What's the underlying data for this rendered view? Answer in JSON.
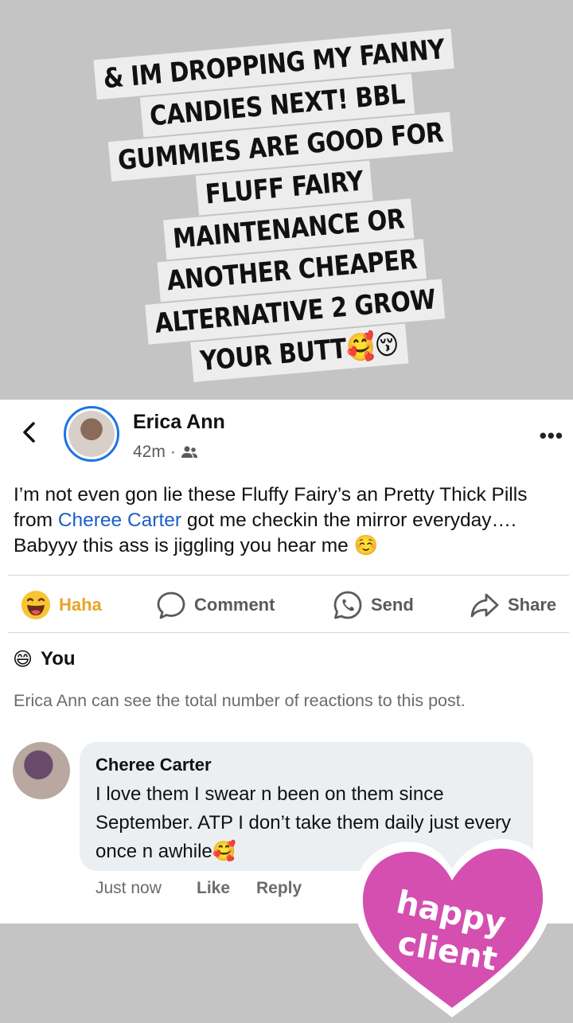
{
  "caption": {
    "lines": [
      "& IM DROPPING MY FANNY",
      "CANDIES NEXT! BBL",
      "GUMMIES ARE GOOD FOR",
      "FLUFF FAIRY",
      "MAINTENANCE OR",
      "ANOTHER CHEAPER",
      "ALTERNATIVE 2 GROW",
      "YOUR BUTT🥰😚"
    ]
  },
  "post": {
    "author": "Erica Ann",
    "time": "42m",
    "text_before_link": "I’m not even gon lie these Fluffy Fairy’s an Pretty Thick Pills from ",
    "link": "Cheree Carter",
    "text_after_link": " got me checkin the mirror everyday…. Babyyy this ass is jiggling you hear me ☺️"
  },
  "actions": {
    "haha": "Haha",
    "comment": "Comment",
    "send": "Send",
    "share": "Share"
  },
  "reaction": {
    "emoji": "😄",
    "name": "You",
    "notice": "Erica Ann can see the total number of reactions to this post."
  },
  "comment": {
    "author": "Cheree Carter",
    "text": "I love them I swear n been on them since September. ATP I don’t take them daily just every once n awhile🥰",
    "time": "Just now",
    "like": "Like",
    "reply": "Reply"
  },
  "sticker": {
    "line1": "happy",
    "line2": "client"
  },
  "colors": {
    "accent_blue": "#1b74e4",
    "haha_yellow": "#e9a327",
    "sticker_pink": "#d44fb0"
  }
}
